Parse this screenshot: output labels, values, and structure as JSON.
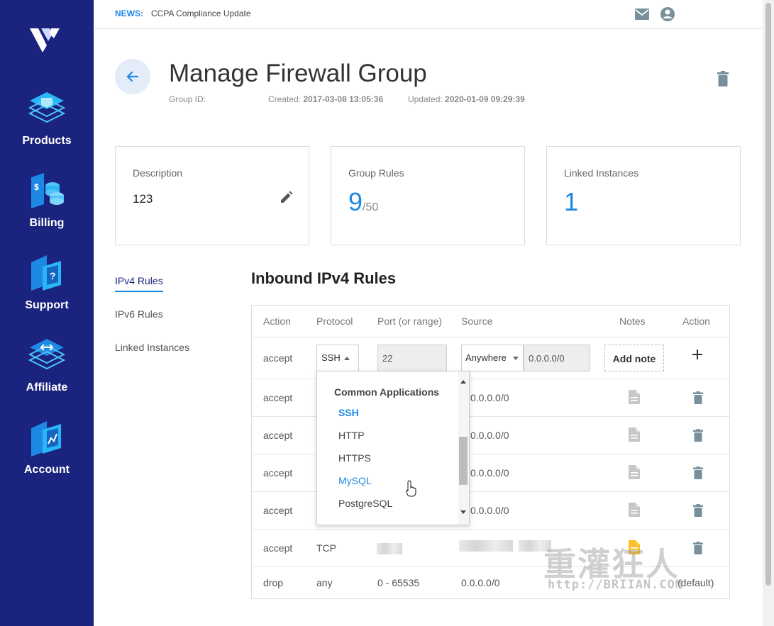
{
  "sidebar": {
    "logo": "vultr-logo",
    "items": [
      {
        "label": "Products",
        "icon": "products-icon"
      },
      {
        "label": "Billing",
        "icon": "billing-icon"
      },
      {
        "label": "Support",
        "icon": "support-icon"
      },
      {
        "label": "Affiliate",
        "icon": "affiliate-icon"
      },
      {
        "label": "Account",
        "icon": "account-icon"
      }
    ]
  },
  "topbar": {
    "news_label": "NEWS:",
    "news_text": "CCPA Compliance Update",
    "mail_icon": "mail-icon",
    "user_icon": "user-icon"
  },
  "header": {
    "title": "Manage Firewall Group",
    "group_id_label": "Group ID:",
    "created_label": "Created:",
    "created_value": "2017-03-08 13:05:36",
    "updated_label": "Updated:",
    "updated_value": "2020-01-09 09:29:39"
  },
  "cards": {
    "description": {
      "label": "Description",
      "value": "123"
    },
    "group_rules": {
      "label": "Group Rules",
      "value": "9",
      "max": "/50"
    },
    "linked": {
      "label": "Linked Instances",
      "value": "1"
    }
  },
  "subnav": [
    {
      "label": "IPv4 Rules",
      "active": true
    },
    {
      "label": "IPv6 Rules",
      "active": false
    },
    {
      "label": "Linked Instances",
      "active": false
    }
  ],
  "section_title": "Inbound IPv4 Rules",
  "table": {
    "headers": [
      "Action",
      "Protocol",
      "Port (or range)",
      "Source",
      "Notes",
      "Action"
    ],
    "new_rule": {
      "action": "accept",
      "protocol": "SSH",
      "port": "22",
      "source_type": "Anywhere",
      "source_value": "0.0.0.0/0",
      "add_note": "Add note"
    },
    "rows": [
      {
        "action": "accept",
        "source": "0.0.0.0/0"
      },
      {
        "action": "accept",
        "source": "0.0.0.0/0"
      },
      {
        "action": "accept",
        "source": "0.0.0.0/0"
      },
      {
        "action": "accept",
        "source": "0.0.0.0/0"
      },
      {
        "action": "accept",
        "protocol": "TCP"
      },
      {
        "action": "drop",
        "protocol": "any",
        "port": "0 - 65535",
        "source": "0.0.0.0/0",
        "note": "(default)"
      }
    ]
  },
  "dropdown": {
    "heading": "Common Applications",
    "items": [
      "SSH",
      "HTTP",
      "HTTPS",
      "MySQL",
      "PostgreSQL"
    ],
    "selected": "SSH",
    "hovered": "MySQL"
  },
  "watermark": {
    "chinese": "重灌狂人",
    "url": "http://BRIIAN.COM"
  },
  "colors": {
    "sidebar": "#1a237e",
    "accent": "#1e88e5",
    "note_active": "#fbc02d"
  }
}
